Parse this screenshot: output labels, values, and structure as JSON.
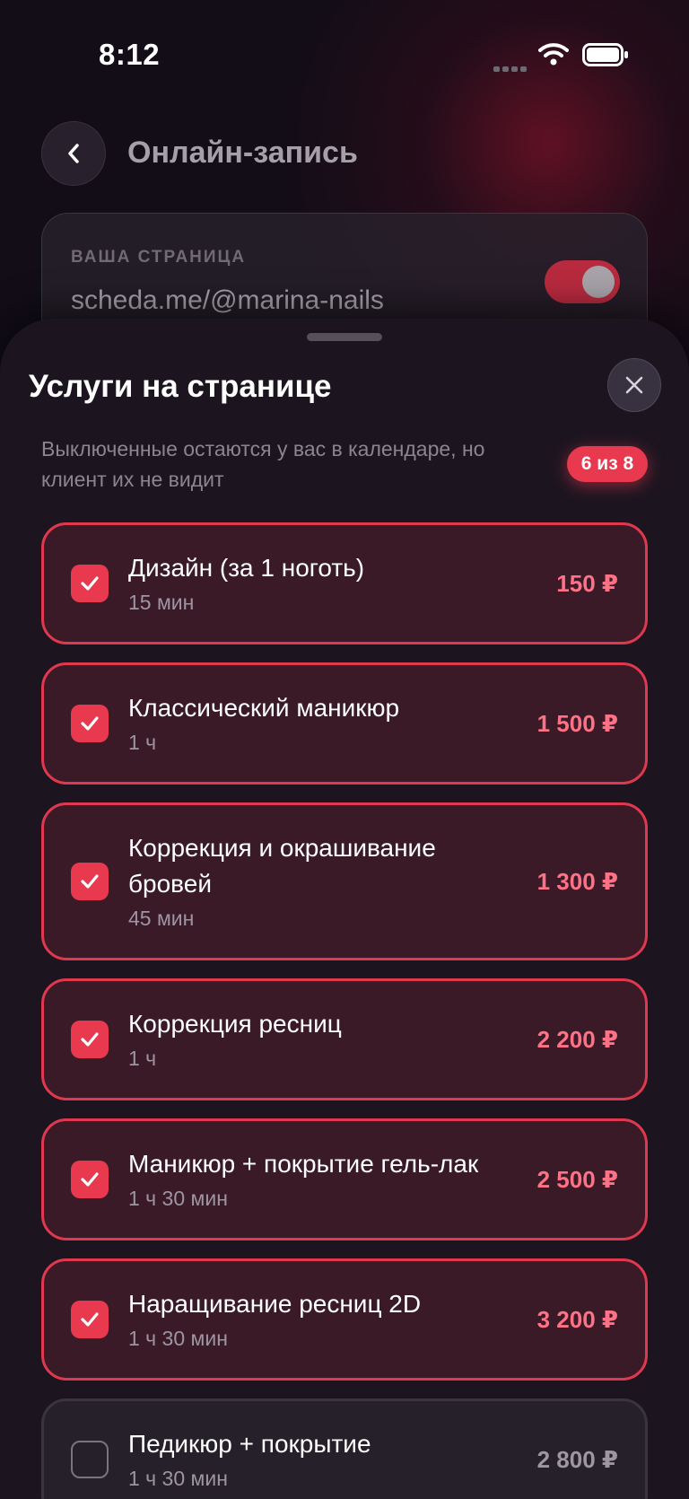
{
  "status_bar": {
    "time": "8:12"
  },
  "header": {
    "title": "Онлайн-запись"
  },
  "page_card": {
    "label": "ВАША СТРАНИЦА",
    "url": "scheda.me/@marina-nails",
    "toggle_on": true
  },
  "sheet": {
    "title": "Услуги на странице",
    "hint": "Выключенные остаются у вас в календаре, но клиент их не видит",
    "count_badge": "6 из 8",
    "services": [
      {
        "name": "Дизайн (за 1 ноготь)",
        "duration": "15 мин",
        "price": "150 ₽",
        "checked": true
      },
      {
        "name": "Классический маникюр",
        "duration": "1 ч",
        "price": "1 500 ₽",
        "checked": true
      },
      {
        "name": "Коррекция и окрашивание бровей",
        "duration": "45 мин",
        "price": "1 300 ₽",
        "checked": true
      },
      {
        "name": "Коррекция ресниц",
        "duration": "1 ч",
        "price": "2 200 ₽",
        "checked": true
      },
      {
        "name": "Маникюр + покрытие гель-лак",
        "duration": "1 ч 30 мин",
        "price": "2 500 ₽",
        "checked": true
      },
      {
        "name": "Наращивание ресниц 2D",
        "duration": "1 ч 30 мин",
        "price": "3 200 ₽",
        "checked": true
      },
      {
        "name": "Педикюр + покрытие",
        "duration": "1 ч 30 мин",
        "price": "2 800 ₽",
        "checked": false
      }
    ]
  },
  "colors": {
    "accent": "#e8394f",
    "price_on": "#ff7286",
    "background": "#120d17",
    "sheet": "#1c1520"
  },
  "icons": {
    "back": "chevron-left-icon",
    "close": "close-icon",
    "check": "checkmark-icon",
    "wifi": "wifi-icon",
    "battery": "battery-icon",
    "signal": "signal-icon"
  }
}
